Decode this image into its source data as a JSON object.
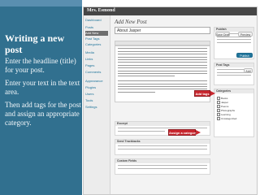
{
  "slide": {
    "heading": "Writing a new post",
    "paragraphs": [
      "Enter the headline (title) for your post.",
      "Enter your text in the text area.",
      "Then add tags for the post and assign an appropriate category."
    ]
  },
  "wp": {
    "site_title": "Mrs. Esmond",
    "page_heading": "Add New Post",
    "post_title": "About Jasper",
    "sidebar_items": [
      "Dashboard",
      "Posts",
      "Add New",
      "Post Tags",
      "Categories",
      "Media",
      "Links",
      "Pages",
      "Comments",
      "Appearance",
      "Plugins",
      "Users",
      "Tools",
      "Settings"
    ],
    "boxes": {
      "publish": "Publish",
      "save_draft": "Save Draft",
      "preview": "Preview",
      "publish_button": "Publish",
      "post_tags": "Post Tags",
      "add_button": "Add",
      "categories": "Categories",
      "excerpt": "Excerpt",
      "send_trackbacks": "Send Trackbacks",
      "custom_fields": "Custom Fields"
    },
    "category_list": [
      "Books",
      "Jasper",
      "Poems",
      "Photographs",
      "Learning",
      "Uncategorized"
    ]
  },
  "callouts": {
    "tags": "Add tags",
    "category": "Assign a category"
  },
  "colors": {
    "left_panel": "#31708f",
    "callout": "#c9272f"
  }
}
